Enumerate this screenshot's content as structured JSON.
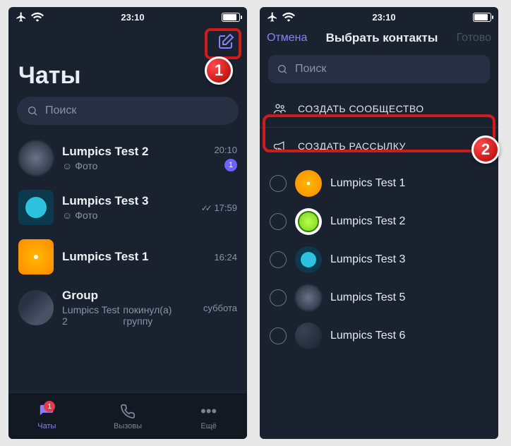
{
  "status": {
    "time": "23:10"
  },
  "left": {
    "title": "Чаты",
    "search_placeholder": "Поиск",
    "chats": [
      {
        "name": "Lumpics Test 2",
        "sub_icon": "☺",
        "sub": "Фото",
        "time": "20:10",
        "unread": "1"
      },
      {
        "name": "Lumpics Test 3",
        "sub_icon": "☺",
        "sub": "Фото",
        "time": "17:59",
        "read": true
      },
      {
        "name": "Lumpics Test 1",
        "sub": "",
        "time": "16:24"
      },
      {
        "name": "Group",
        "sub": "Lumpics Test 2",
        "sub2": "покинул(а) группу",
        "time": "суббота"
      }
    ],
    "tabs": {
      "chats": "Чаты",
      "calls": "Вызовы",
      "more": "Ещё",
      "badge": "1"
    }
  },
  "right": {
    "cancel": "Отмена",
    "title": "Выбрать контакты",
    "done": "Готово",
    "search_placeholder": "Поиск",
    "create_community": "СОЗДАТЬ СООБЩЕСТВО",
    "create_broadcast": "СОЗДАТЬ РАССЫЛКУ",
    "contacts": [
      {
        "name": "Lumpics Test 1"
      },
      {
        "name": "Lumpics Test 2"
      },
      {
        "name": "Lumpics Test 3"
      },
      {
        "name": "Lumpics Test 5"
      },
      {
        "name": "Lumpics Test 6"
      }
    ]
  },
  "markers": {
    "one": "1",
    "two": "2"
  }
}
